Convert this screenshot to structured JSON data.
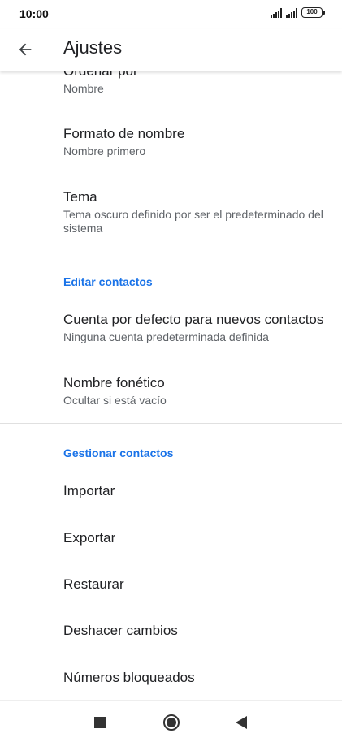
{
  "status": {
    "time": "10:00",
    "battery": "100"
  },
  "appbar": {
    "title": "Ajustes"
  },
  "items": {
    "ordenar": {
      "title": "Ordenar por",
      "subtitle": "Nombre"
    },
    "formato": {
      "title": "Formato de nombre",
      "subtitle": "Nombre primero"
    },
    "tema": {
      "title": "Tema",
      "subtitle": "Tema oscuro definido por ser el predeterminado del sistema"
    },
    "cuenta": {
      "title": "Cuenta por defecto para nuevos contactos",
      "subtitle": "Ninguna cuenta predeterminada definida"
    },
    "fonetico": {
      "title": "Nombre fonético",
      "subtitle": "Ocultar si está vacío"
    }
  },
  "sections": {
    "editar": "Editar contactos",
    "gestionar": "Gestionar contactos"
  },
  "actions": {
    "importar": "Importar",
    "exportar": "Exportar",
    "restaurar": "Restaurar",
    "deshacer": "Deshacer cambios",
    "bloqueados": "Números bloqueados"
  },
  "colors": {
    "accent": "#1a73e8",
    "text": "#202124",
    "secondary": "#5f6368"
  }
}
